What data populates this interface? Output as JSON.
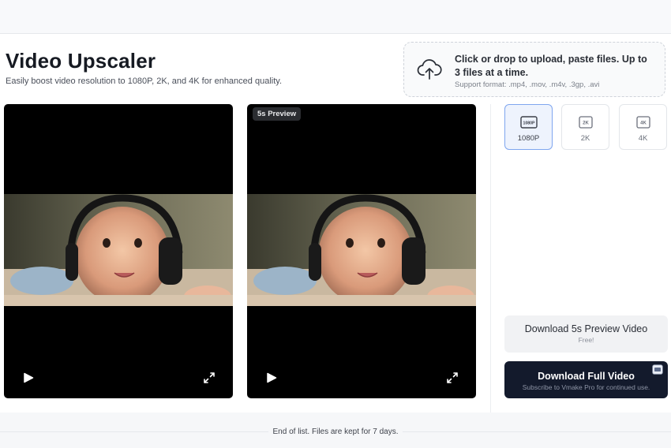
{
  "header": {
    "title": "Video Upscaler",
    "subtitle": "Easily boost video resolution to 1080P, 2K, and 4K for enhanced quality."
  },
  "upload": {
    "icon": "cloud-upload-icon",
    "text": "Click or drop to upload, paste files. Up to 3 files at a time.",
    "support": "Support format: .mp4, .mov, .m4v, .3gp, .avi"
  },
  "videos": {
    "original": {
      "icons": [
        "play-icon",
        "fullscreen-icon"
      ]
    },
    "preview": {
      "badge": "5s Preview",
      "icons": [
        "play-icon",
        "fullscreen-icon"
      ]
    }
  },
  "resolutions": [
    {
      "label": "1080P",
      "icon_text": "1080P",
      "selected": true
    },
    {
      "label": "2K",
      "icon_text": "2K",
      "selected": false
    },
    {
      "label": "4K",
      "icon_text": "4K",
      "selected": false
    }
  ],
  "actions": {
    "preview_label": "Download 5s Preview Video",
    "preview_sub": "Free!",
    "full_label": "Download Full Video",
    "full_sub": "Subscribe to Vmake Pro for continued use."
  },
  "footer": {
    "text": "End of list. Files are kept for 7 days."
  },
  "colors": {
    "accent": "#7fa6ef",
    "dark_button": "#131a2c",
    "background": "#f7f8fa"
  }
}
